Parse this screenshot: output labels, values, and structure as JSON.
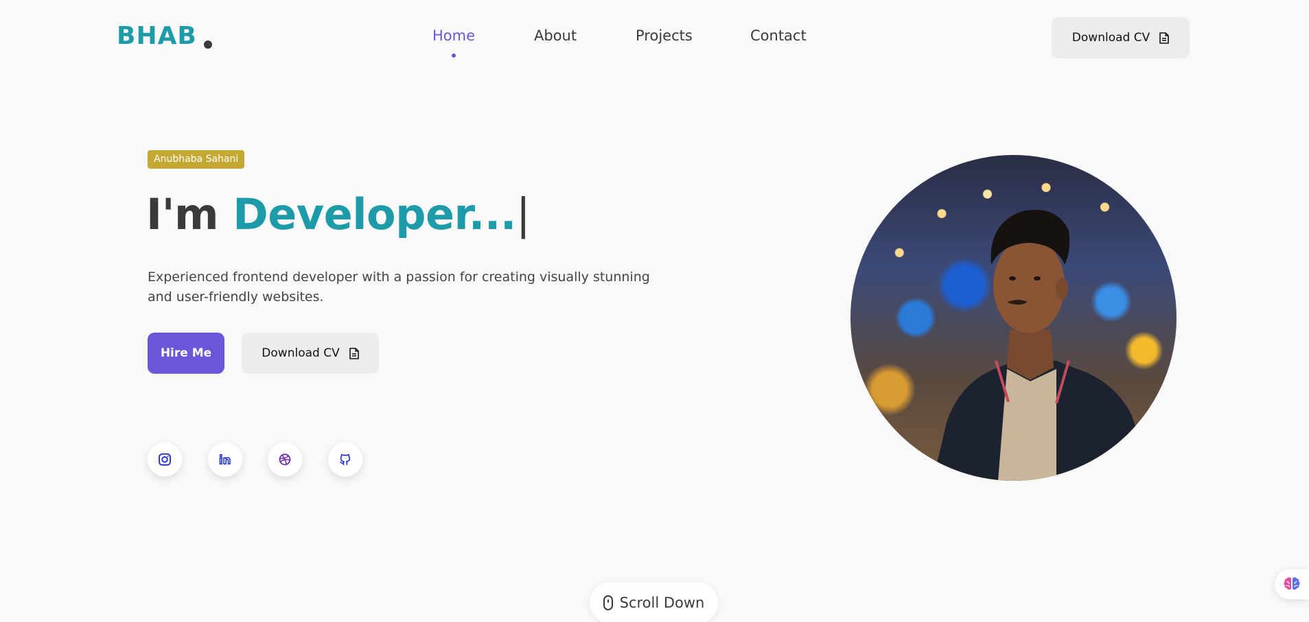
{
  "header": {
    "logo_text": "BHAB",
    "nav": [
      {
        "label": "Home",
        "active": true
      },
      {
        "label": "About",
        "active": false
      },
      {
        "label": "Projects",
        "active": false
      },
      {
        "label": "Contact",
        "active": false
      }
    ],
    "download_cv_label": "Download CV"
  },
  "hero": {
    "name_badge": "Anubhaba Sahani",
    "headline_prefix": "I'm",
    "headline_accent": "Developer...",
    "headline_cursor": "|",
    "description": "Experienced frontend developer with a passion for creating visually stunning and user-friendly websites.",
    "hire_me_label": "Hire Me",
    "download_cv_label": "Download CV"
  },
  "social_icons": [
    "instagram-icon",
    "linkedin-icon",
    "dribbble-icon",
    "github-icon"
  ],
  "scroll_label": "Scroll Down",
  "colors": {
    "accent_teal": "#1e9ba8",
    "accent_purple": "#6b56d9",
    "badge_gold": "#c5a833",
    "background": "#f9f9f9"
  }
}
